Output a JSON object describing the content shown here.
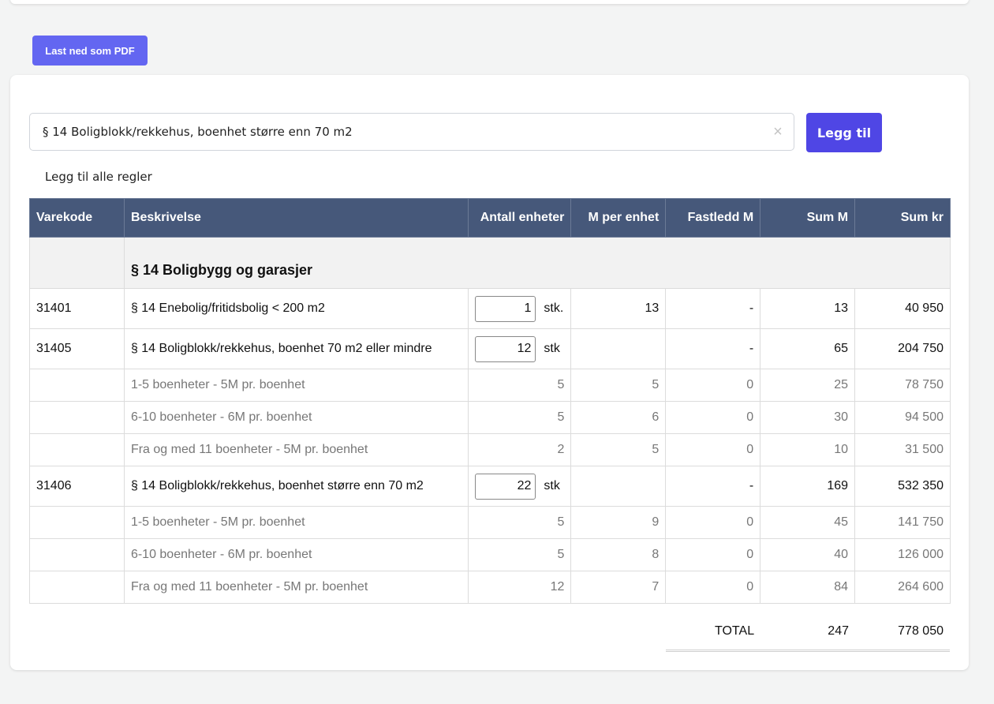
{
  "toolbar": {
    "pdf_label": "Last ned som PDF"
  },
  "search": {
    "value": "§ 14 Boligblokk/rekkehus, boenhet større enn 70 m2",
    "clear_glyph": "×",
    "add_label": "Legg til"
  },
  "add_all_label": "Legg til alle regler",
  "table": {
    "headers": {
      "code": "Varekode",
      "desc": "Beskrivelse",
      "units": "Antall enheter",
      "m_per_unit": "M per enhet",
      "fixed_m": "Fastledd M",
      "sum_m": "Sum M",
      "sum_kr": "Sum kr"
    },
    "section": "§ 14 Boligbygg og garasjer",
    "rows": [
      {
        "code": "31401",
        "desc": "§ 14 Enebolig/fritidsbolig < 200 m2",
        "qty": "1",
        "unit": "stk.",
        "m_per_unit": "13",
        "fixed_m": "-",
        "sum_m": "13",
        "sum_kr": "40 950"
      },
      {
        "code": "31405",
        "desc": "§ 14 Boligblokk/rekkehus, boenhet 70 m2 eller mindre",
        "qty": "12",
        "unit": "stk",
        "m_per_unit": "",
        "fixed_m": "-",
        "sum_m": "65",
        "sum_kr": "204 750"
      },
      {
        "desc": "1-5 boenheter - 5M pr. boenhet",
        "units": "5",
        "m_per_unit": "5",
        "fixed_m": "0",
        "sum_m": "25",
        "sum_kr": "78 750"
      },
      {
        "desc": "6-10 boenheter - 6M pr. boenhet",
        "units": "5",
        "m_per_unit": "6",
        "fixed_m": "0",
        "sum_m": "30",
        "sum_kr": "94 500"
      },
      {
        "desc": "Fra og med 11 boenheter - 5M pr. boenhet",
        "units": "2",
        "m_per_unit": "5",
        "fixed_m": "0",
        "sum_m": "10",
        "sum_kr": "31 500"
      },
      {
        "code": "31406",
        "desc": "§ 14 Boligblokk/rekkehus, boenhet større enn 70 m2",
        "qty": "22",
        "unit": "stk",
        "m_per_unit": "",
        "fixed_m": "-",
        "sum_m": "169",
        "sum_kr": "532 350"
      },
      {
        "desc": "1-5 boenheter - 5M pr. boenhet",
        "units": "5",
        "m_per_unit": "9",
        "fixed_m": "0",
        "sum_m": "45",
        "sum_kr": "141 750"
      },
      {
        "desc": "6-10 boenheter - 6M pr. boenhet",
        "units": "5",
        "m_per_unit": "8",
        "fixed_m": "0",
        "sum_m": "40",
        "sum_kr": "126 000"
      },
      {
        "desc": "Fra og med 11 boenheter - 5M pr. boenhet",
        "units": "12",
        "m_per_unit": "7",
        "fixed_m": "0",
        "sum_m": "84",
        "sum_kr": "264 600"
      }
    ]
  },
  "totals": {
    "label": "TOTAL",
    "sum_m": "247",
    "sum_kr": "778 050"
  }
}
